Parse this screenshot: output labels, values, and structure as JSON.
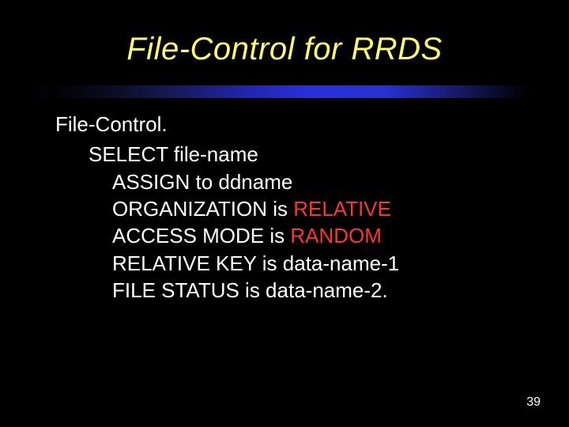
{
  "title": "File-Control for RRDS",
  "section": "File-Control.",
  "lines": {
    "l1_a": "SELECT file-name",
    "l2_a": "ASSIGN to ddname",
    "l3_a": "ORGANIZATION is ",
    "l3_b": "RELATIVE",
    "l4_a": "ACCESS MODE is ",
    "l4_b": "RANDOM",
    "l5_a": "RELATIVE KEY is data-name-1",
    "l6_a": "FILE STATUS is data-name-2."
  },
  "page": "39"
}
